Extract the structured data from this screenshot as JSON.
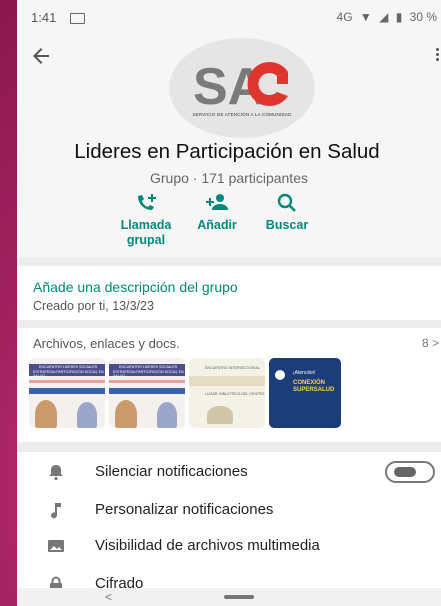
{
  "status": {
    "time": "1:41",
    "network": "4G",
    "battery": "30 %"
  },
  "header": {
    "logo_text": "SAC",
    "logo_subtitle": "SERVICIO DE ATENCIÓN A LA COMUNIDAD",
    "group_name": "Lideres en Participación en Salud",
    "group_subtitle": "Grupo · 171 participantes"
  },
  "actions": {
    "call_label_1": "Llamada",
    "call_label_2": "grupal",
    "add_label": "Añadir",
    "search_label": "Buscar"
  },
  "description": {
    "add_prompt": "Añade una descripción del grupo",
    "created": "Creado por ti, 13/3/23"
  },
  "media": {
    "title": "Archivos, enlaces y docs.",
    "count": "8 >",
    "thumbs": [
      {
        "line1": "ENCUENTRO LIDERES SOCIALES",
        "line2": "ESTRATEGIA PARTICIPACIÓN SOCIAL EN SALUD"
      },
      {
        "line1": "ENCUENTRO LIDERES SOCIALES",
        "line2": "ESTRATEGIA PARTICIPACIÓN SOCIAL EN SALUD"
      },
      {
        "line1": "ENCUENTRO INTERSECTORIAL",
        "line2": "LUGAR: BIBLIOTECA DEL CENTRO"
      },
      {
        "line1": "¡Atención!",
        "line2": "CONEXIÓN SUPERSALUD"
      }
    ]
  },
  "settings": {
    "mute": "Silenciar notificaciones",
    "custom": "Personalizar notificaciones",
    "media_visibility": "Visibilidad de archivos multimedia",
    "encryption": "Cifrado"
  },
  "navbar": {
    "back": "<"
  },
  "colors": {
    "accent": "#00897b",
    "logo_red": "#e0342f",
    "logo_gray": "#7a7a7a",
    "frame": "#a3225f"
  }
}
